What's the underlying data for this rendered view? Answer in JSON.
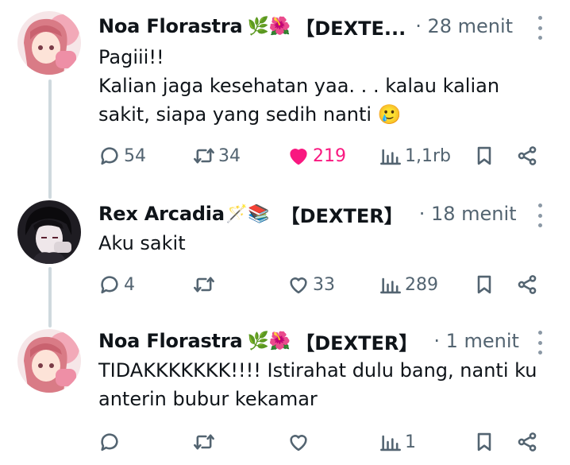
{
  "colors": {
    "text": "#0f1419",
    "muted": "#536471",
    "like_active": "#f91880",
    "thread_line": "#cfd9de"
  },
  "tweets": [
    {
      "author": "Noa Florastra",
      "emojis": "🌿🌺",
      "tag": "【DEXTE...",
      "time": "· 28 menit",
      "text": "Pagiii!!\nKalian jaga kesehatan yaa. . . kalau kalian sakit, siapa yang sedih nanti 🥲",
      "replies": "54",
      "reposts": "34",
      "likes": "219",
      "liked": true,
      "views": "1,1rb"
    },
    {
      "author": "Rex Arcadia",
      "emojis": "🪄📚",
      "tag": "【DEXTER】",
      "time": "· 18 menit",
      "text": "Aku sakit",
      "replies": "4",
      "reposts": "",
      "likes": "33",
      "liked": false,
      "views": "289"
    },
    {
      "author": "Noa Florastra",
      "emojis": "🌿🌺",
      "tag": "【DEXTER】",
      "time": "· 1 menit",
      "text": "TIDAKKKKKKK!!!! Istirahat dulu bang, nanti ku anterin bubur kekamar",
      "replies": "",
      "reposts": "",
      "likes": "",
      "liked": false,
      "views": "1"
    }
  ]
}
